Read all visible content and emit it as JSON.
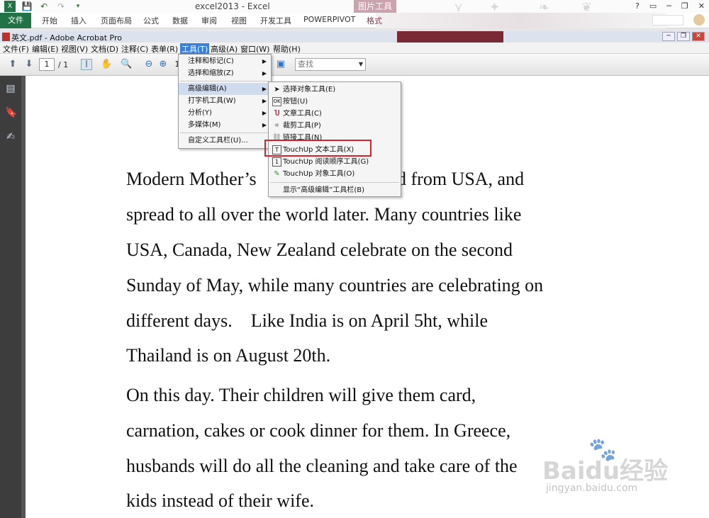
{
  "excel": {
    "title": "excel2013 - Excel",
    "context_tab_group": "图片工具",
    "tabs": [
      "开始",
      "插入",
      "页面布局",
      "公式",
      "数据",
      "审阅",
      "视图",
      "开发工具",
      "POWERPIVOT",
      "格式"
    ],
    "file_tab": "文件",
    "window_buttons": [
      "?",
      "▭",
      "─",
      "❐",
      "✕"
    ]
  },
  "acrobat": {
    "title": "英文.pdf - Adobe Acrobat Pro",
    "menubar": [
      "文件(F)",
      "编辑(E)",
      "视图(V)",
      "文档(D)",
      "注释(C)",
      "表单(R)",
      "工具(T)",
      "高级(A)",
      "窗口(W)",
      "帮助(H)"
    ],
    "active_menu": "工具(T)",
    "page_current": "1",
    "page_total": "/ 1",
    "zoom_partial": "1",
    "search_placeholder": "查找"
  },
  "tools_menu": {
    "items": [
      {
        "label": "注释和标记(C)",
        "submenu": true
      },
      {
        "label": "选择和缩放(Z)",
        "submenu": true
      },
      {
        "label": "高级编辑(A)",
        "submenu": true,
        "highlighted": true
      },
      {
        "label": "打字机工具(W)",
        "submenu": true
      },
      {
        "label": "分析(Y)",
        "submenu": true
      },
      {
        "label": "多媒体(M)",
        "submenu": true
      },
      {
        "label": "自定义工具栏(U)...",
        "submenu": false
      }
    ]
  },
  "advanced_edit_menu": {
    "items": [
      {
        "label": "选择对象工具(E)",
        "icon": "arrow-cursor-icon"
      },
      {
        "label": "按钮(U)",
        "icon": "ok-button-icon"
      },
      {
        "label": "文章工具(C)",
        "icon": "article-icon"
      },
      {
        "label": "裁剪工具(P)",
        "icon": "crop-icon"
      },
      {
        "label": "链接工具(N)",
        "icon": "link-icon"
      },
      {
        "label": "TouchUp 文本工具(X)",
        "icon": "touchup-text-icon",
        "boxed": true
      },
      {
        "label": "TouchUp 阅读顺序工具(G)",
        "icon": "reading-order-icon"
      },
      {
        "label": "TouchUp 对象工具(O)",
        "icon": "touchup-object-icon"
      },
      {
        "label": "显示“高级编辑”工具栏(B)",
        "icon": ""
      }
    ]
  },
  "document": {
    "lines": [
      "Modern Mother’s",
      "d from USA, and",
      "spread to all over the world later. Many countries like",
      "USA, Canada, New Zealand celebrate on the second",
      "Sunday of May, while many countries are celebrating on",
      "different days.    Like India is on April 5ht, while",
      "Thailand is on August 20th.",
      "On this day. Their children will give them card,",
      "carnation, cakes or cook dinner for them. In Greece,",
      "husbands will do all the cleaning and take care of the",
      "kids instead of their wife."
    ]
  },
  "watermark": {
    "brand": "Baidu经验",
    "url": "jingyan.baidu.com"
  },
  "colors": {
    "excel_green": "#217346",
    "menu_highlight": "#cfdcf0",
    "red_box": "#d6202a",
    "acrobat_nav": "#3d3d3d"
  }
}
